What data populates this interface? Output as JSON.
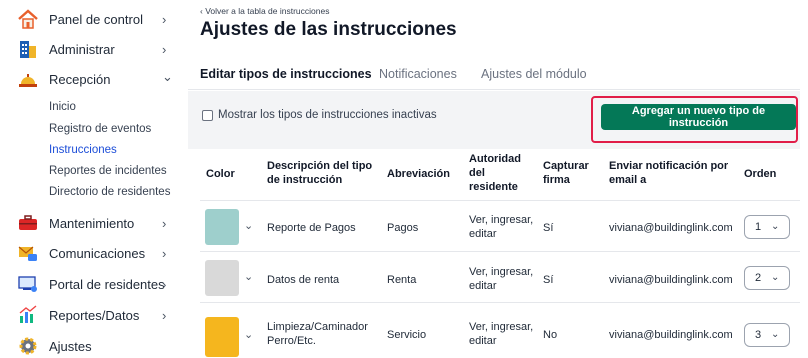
{
  "sidebar": {
    "items": [
      {
        "label": "Panel de control",
        "icon": "home-icon",
        "chevron": "›"
      },
      {
        "label": "Administrar",
        "icon": "building-icon",
        "chevron": "›"
      },
      {
        "label": "Recepción",
        "icon": "reception-bell-icon",
        "chevron": "⌄"
      },
      {
        "label": "Mantenimiento",
        "icon": "toolbox-icon",
        "chevron": "›"
      },
      {
        "label": "Comunicaciones",
        "icon": "mail-chat-icon",
        "chevron": "›"
      },
      {
        "label": "Portal de residentes",
        "icon": "portal-icon",
        "chevron": "›"
      },
      {
        "label": "Reportes/Datos",
        "icon": "chart-icon",
        "chevron": "›"
      },
      {
        "label": "Ajustes",
        "icon": "gear-icon",
        "chevron": ""
      }
    ],
    "subitems": [
      {
        "label": "Inicio"
      },
      {
        "label": "Registro de eventos"
      },
      {
        "label": "Instrucciones"
      },
      {
        "label": "Reportes de incidentes"
      },
      {
        "label": "Directorio de residentes"
      }
    ]
  },
  "header": {
    "back_link": "‹ Volver a la tabla de instrucciones",
    "title": "Ajustes de las instrucciones"
  },
  "tabs": [
    {
      "label": "Editar tipos de instrucciones"
    },
    {
      "label": "Notificaciones"
    },
    {
      "label": "Ajustes del módulo"
    }
  ],
  "toolbar": {
    "checkbox_label": "Mostrar los tipos de instrucciones inactivas",
    "add_button": "Agregar un nuevo tipo de instrucción"
  },
  "table": {
    "headers": {
      "color": "Color",
      "desc_1": "Descripción del tipo",
      "desc_2": "de instrucción",
      "abbr": "Abreviación",
      "auth_1": "Autoridad",
      "auth_2": "del",
      "auth_3": "residente",
      "sig_1": "Capturar",
      "sig_2": "firma",
      "email_1": "Enviar notificación por",
      "email_2": "email a",
      "order": "Orden"
    },
    "rows": [
      {
        "color": "#9ecfcc",
        "desc_1": "Reporte de Pagos",
        "desc_2": "",
        "abbr": "Pagos",
        "auth_1": "Ver, ingresar,",
        "auth_2": "editar",
        "signature": "Sí",
        "email": "viviana@buildinglink.com",
        "order": "1"
      },
      {
        "color": "#d9d9d9",
        "desc_1": "Datos de renta",
        "desc_2": "",
        "abbr": "Renta",
        "auth_1": "Ver, ingresar,",
        "auth_2": "editar",
        "signature": "Sí",
        "email": "viviana@buildinglink.com",
        "order": "2"
      },
      {
        "color": "#f5b61e",
        "desc_1": "Limpieza/Caminador",
        "desc_2": "Perro/Etc.",
        "abbr": "Servicio",
        "auth_1": "Ver, ingresar,",
        "auth_2": "editar",
        "signature": "No",
        "email": "viviana@buildinglink.com",
        "order": "3"
      }
    ]
  }
}
